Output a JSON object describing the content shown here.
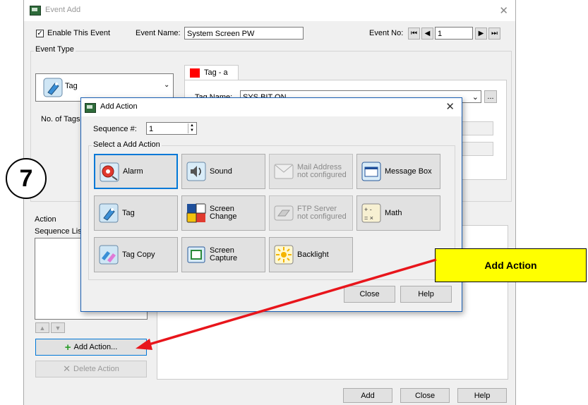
{
  "main_window": {
    "title": "Event Add",
    "enable_label": "Enable This Event",
    "event_name_label": "Event Name:",
    "event_name_value": "System Screen PW",
    "event_no_label": "Event No:",
    "event_no_value": "1",
    "event_type_label": "Event Type",
    "event_type_value": "Tag",
    "tag_tab_label": "Tag - a",
    "tag_name_label": "Tag Name:",
    "tag_name_value": "SYS BIT ON",
    "browse_label": "...",
    "no_of_tags_label": "No. of Tags:",
    "action_label": "Action",
    "sequence_list_label": "Sequence Lis",
    "add_action_label": "Add Action...",
    "delete_action_label": "Delete Action",
    "add_label": "Add",
    "close_label": "Close",
    "help_label": "Help"
  },
  "dialog": {
    "title": "Add Action",
    "sequence_label": "Sequence #:",
    "sequence_value": "1",
    "select_label": "Select a Add Action",
    "actions": [
      {
        "label": "Alarm",
        "icon": "alarm-icon",
        "state": "selected"
      },
      {
        "label": "Sound",
        "icon": "sound-icon",
        "state": "enabled"
      },
      {
        "label": "Mail Address\nnot configured",
        "icon": "mail-icon",
        "state": "disabled"
      },
      {
        "label": "Message Box",
        "icon": "message-box-icon",
        "state": "enabled"
      },
      {
        "label": "Tag",
        "icon": "tag-icon",
        "state": "enabled"
      },
      {
        "label": "Screen\nChange",
        "icon": "screen-change-icon",
        "state": "enabled"
      },
      {
        "label": "FTP Server\nnot configured",
        "icon": "ftp-icon",
        "state": "disabled"
      },
      {
        "label": "Math",
        "icon": "math-icon",
        "state": "enabled"
      },
      {
        "label": "Tag Copy",
        "icon": "tag-copy-icon",
        "state": "enabled"
      },
      {
        "label": "Screen\nCapture",
        "icon": "screen-capture-icon",
        "state": "enabled"
      },
      {
        "label": "Backlight",
        "icon": "backlight-icon",
        "state": "enabled"
      }
    ],
    "close_label": "Close",
    "help_label": "Help"
  },
  "annotation": {
    "step_number": "7",
    "callout_text": "Add Action"
  },
  "colors": {
    "callout": "#ffff00",
    "arrow": "#e8151b",
    "selection": "#0078d7",
    "tag_swatch": "#ff0000"
  }
}
